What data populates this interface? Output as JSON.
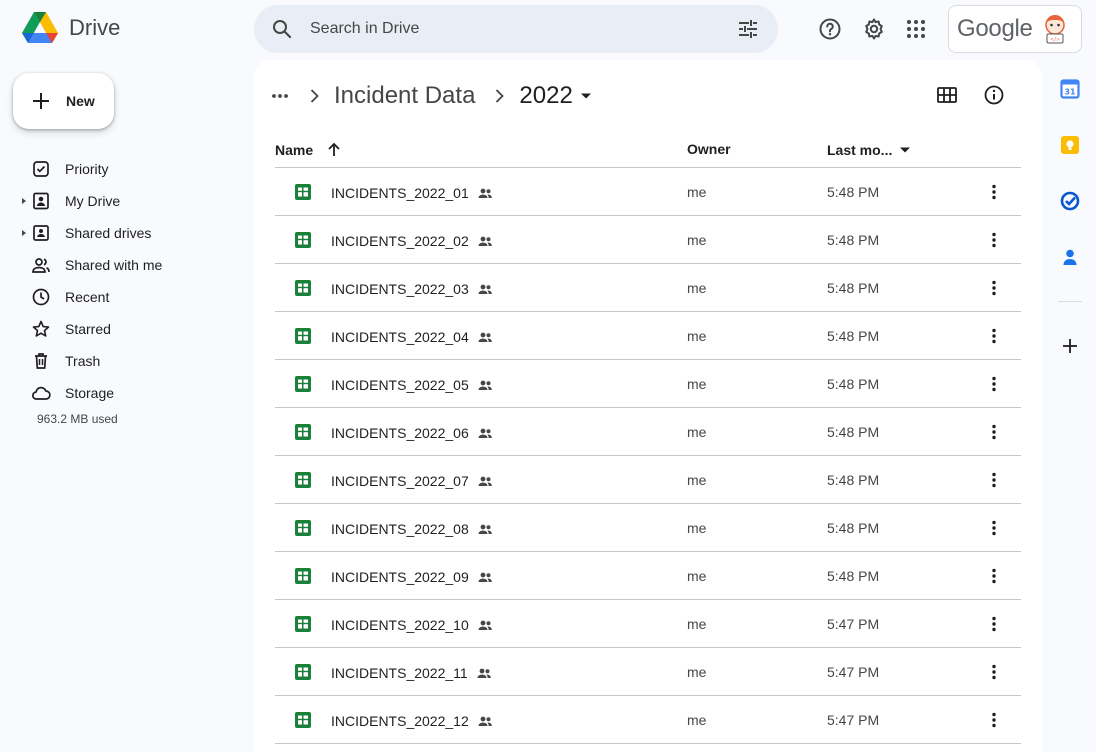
{
  "app": {
    "name": "Drive"
  },
  "search": {
    "placeholder": "Search in Drive"
  },
  "account": {
    "label": "Google"
  },
  "new_button": {
    "label": "New"
  },
  "sidebar": {
    "items": [
      {
        "label": "Priority",
        "icon": "priority-icon"
      },
      {
        "label": "My Drive",
        "icon": "my-drive-icon"
      },
      {
        "label": "Shared drives",
        "icon": "shared-drives-icon"
      },
      {
        "label": "Shared with me",
        "icon": "shared-with-me-icon"
      },
      {
        "label": "Recent",
        "icon": "recent-icon"
      },
      {
        "label": "Starred",
        "icon": "star-icon"
      },
      {
        "label": "Trash",
        "icon": "trash-icon"
      },
      {
        "label": "Storage",
        "icon": "cloud-icon"
      }
    ],
    "storage_used": "963.2 MB used"
  },
  "breadcrumb": {
    "parent": "Incident Data",
    "current": "2022"
  },
  "table": {
    "columns": {
      "name": "Name",
      "owner": "Owner",
      "modified": "Last mo..."
    },
    "rows": [
      {
        "name": "INCIDENTS_2022_01",
        "owner": "me",
        "modified": "5:48 PM"
      },
      {
        "name": "INCIDENTS_2022_02",
        "owner": "me",
        "modified": "5:48 PM"
      },
      {
        "name": "INCIDENTS_2022_03",
        "owner": "me",
        "modified": "5:48 PM"
      },
      {
        "name": "INCIDENTS_2022_04",
        "owner": "me",
        "modified": "5:48 PM"
      },
      {
        "name": "INCIDENTS_2022_05",
        "owner": "me",
        "modified": "5:48 PM"
      },
      {
        "name": "INCIDENTS_2022_06",
        "owner": "me",
        "modified": "5:48 PM"
      },
      {
        "name": "INCIDENTS_2022_07",
        "owner": "me",
        "modified": "5:48 PM"
      },
      {
        "name": "INCIDENTS_2022_08",
        "owner": "me",
        "modified": "5:48 PM"
      },
      {
        "name": "INCIDENTS_2022_09",
        "owner": "me",
        "modified": "5:48 PM"
      },
      {
        "name": "INCIDENTS_2022_10",
        "owner": "me",
        "modified": "5:47 PM"
      },
      {
        "name": "INCIDENTS_2022_11",
        "owner": "me",
        "modified": "5:47 PM"
      },
      {
        "name": "INCIDENTS_2022_12",
        "owner": "me",
        "modified": "5:47 PM"
      }
    ]
  },
  "rail": {
    "calendar_day": "31"
  },
  "colors": {
    "sheets_green": "#188038",
    "calendar_blue": "#4285f4",
    "keep_yellow": "#fbbc04",
    "tasks_blue": "#0b57d0",
    "contacts_blue": "#1a73e8"
  }
}
